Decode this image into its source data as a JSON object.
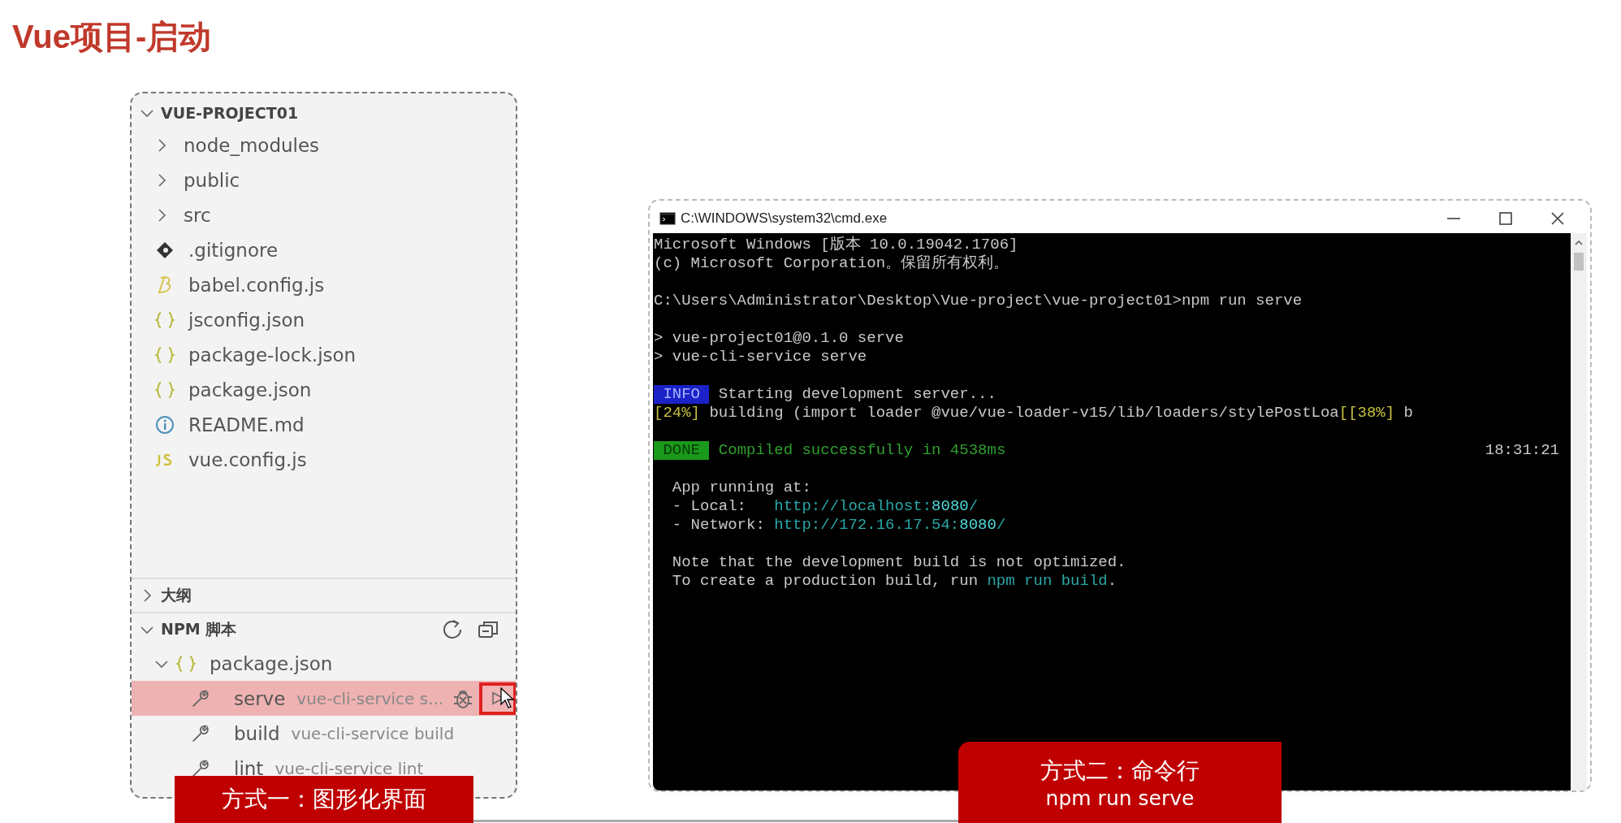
{
  "slide_title": "Vue项目-启动",
  "explorer": {
    "title": "VUE-PROJECT01",
    "expanded": true,
    "children": [
      {
        "label": "node_modules",
        "kind": "folder",
        "expanded": false
      },
      {
        "label": "public",
        "kind": "folder",
        "expanded": false
      },
      {
        "label": "src",
        "kind": "folder",
        "expanded": false
      },
      {
        "label": ".gitignore",
        "kind": "git"
      },
      {
        "label": "babel.config.js",
        "kind": "babel"
      },
      {
        "label": "jsconfig.json",
        "kind": "json"
      },
      {
        "label": "package-lock.json",
        "kind": "json"
      },
      {
        "label": "package.json",
        "kind": "json"
      },
      {
        "label": "README.md",
        "kind": "info"
      },
      {
        "label": "vue.config.js",
        "kind": "js"
      }
    ]
  },
  "outline": {
    "label": "大纲",
    "expanded": false
  },
  "npm_scripts": {
    "label": "NPM 脚本",
    "expanded": true,
    "children": [
      {
        "label": "package.json",
        "expanded": true,
        "children": [
          {
            "name": "serve",
            "command": "vue-cli-service s...",
            "selected": true
          },
          {
            "name": "build",
            "command": "vue-cli-service build",
            "selected": false
          },
          {
            "name": "lint",
            "command": "vue-cli-service lint",
            "selected": false
          }
        ]
      }
    ]
  },
  "cmd_window": {
    "title": "C:\\WINDOWS\\system32\\cmd.exe",
    "lines": [
      {
        "segments": [
          {
            "text": "Microsoft Windows [版本 10.0.19042.1706]",
            "kind": "plain"
          }
        ]
      },
      {
        "segments": [
          {
            "text": "(c) Microsoft Corporation。保留所有权利。",
            "kind": "plain"
          }
        ]
      },
      {
        "kind": "blank"
      },
      {
        "segments": [
          {
            "text": "C:\\Users\\Administrator\\Desktop\\Vue-project\\vue-project01>npm run serve",
            "kind": "plain"
          }
        ]
      },
      {
        "kind": "blank"
      },
      {
        "segments": [
          {
            "text": "> vue-project01@0.1.0 serve",
            "kind": "plain"
          }
        ]
      },
      {
        "segments": [
          {
            "text": "> vue-cli-service serve",
            "kind": "plain"
          }
        ]
      },
      {
        "kind": "blank"
      },
      {
        "segments": [
          {
            "text": " INFO ",
            "kind": "info_badge"
          },
          {
            "text": " Starting development server...",
            "kind": "plain"
          }
        ]
      },
      {
        "segments": [
          {
            "text": "[24%]",
            "kind": "progress"
          },
          {
            "text": " building (import loader @vue/vue-loader-v15/lib/loaders/stylePostLoa",
            "kind": "plain"
          },
          {
            "text": "[[38%]",
            "kind": "progress"
          },
          {
            "text": " b",
            "kind": "plain"
          }
        ]
      },
      {
        "kind": "blank"
      },
      {
        "segments": [
          {
            "text": " DONE ",
            "kind": "done_badge"
          },
          {
            "text": " Compiled successfully in 4538ms",
            "kind": "success"
          },
          {
            "text": "18:31:21",
            "kind": "time"
          }
        ]
      },
      {
        "kind": "blank"
      },
      {
        "segments": [
          {
            "text": "  App running at:",
            "kind": "plain"
          }
        ]
      },
      {
        "segments": [
          {
            "text": "  - Local:   ",
            "kind": "plain"
          },
          {
            "text": "http://localhost:",
            "kind": "link"
          },
          {
            "text": "8080",
            "kind": "link_bright"
          },
          {
            "text": "/",
            "kind": "link"
          }
        ]
      },
      {
        "segments": [
          {
            "text": "  - Network: ",
            "kind": "plain"
          },
          {
            "text": "http://172.16.17.54:",
            "kind": "link"
          },
          {
            "text": "8080",
            "kind": "link_bright"
          },
          {
            "text": "/",
            "kind": "link"
          }
        ]
      },
      {
        "kind": "blank"
      },
      {
        "segments": [
          {
            "text": "  Note that the development build is not optimized.",
            "kind": "plain"
          }
        ]
      },
      {
        "segments": [
          {
            "text": "  To create a production build, run ",
            "kind": "plain"
          },
          {
            "text": "npm run build",
            "kind": "link"
          },
          {
            "text": ".",
            "kind": "plain"
          }
        ]
      }
    ]
  },
  "callouts": [
    {
      "lines": [
        "方式一：图形化界面"
      ],
      "kind": "left"
    },
    {
      "lines": [
        "方式二：命令行",
        "npm run serve"
      ],
      "kind": "right"
    }
  ]
}
